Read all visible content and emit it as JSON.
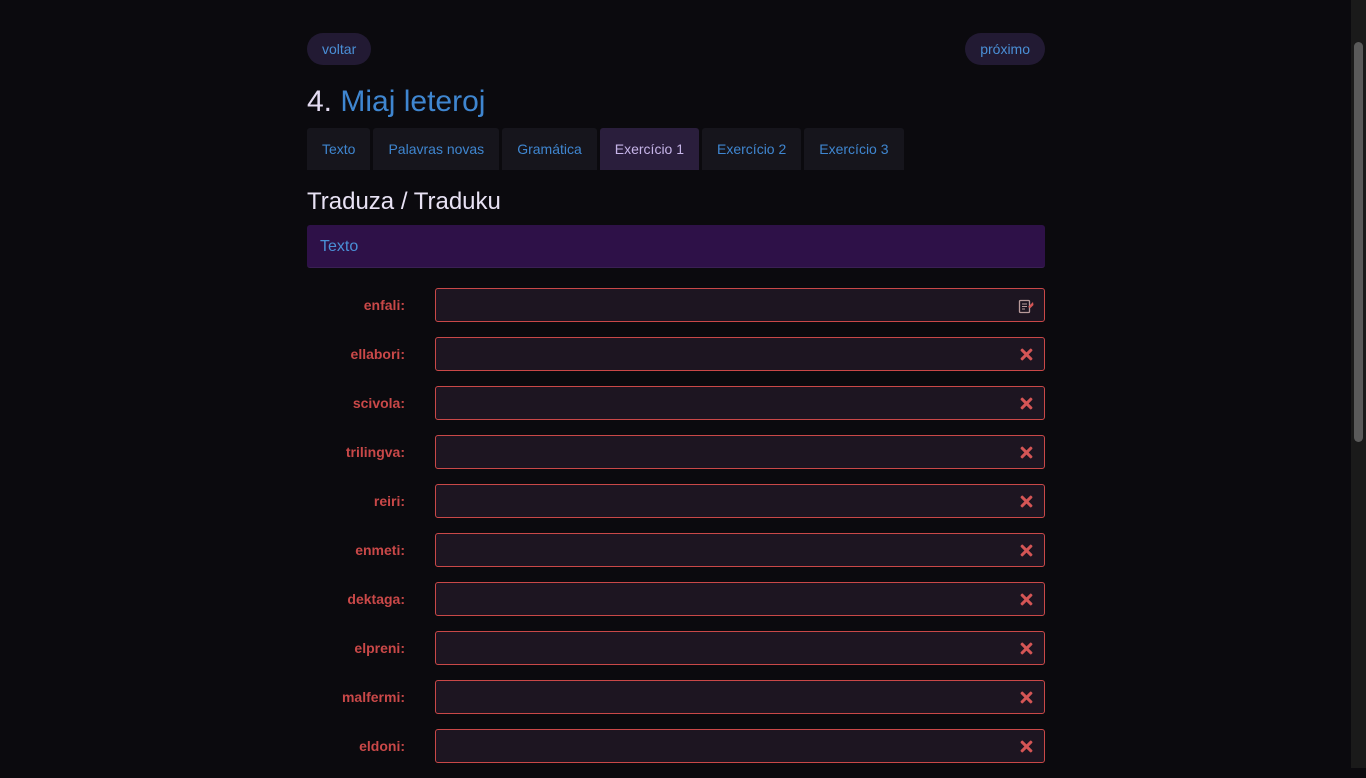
{
  "nav": {
    "prev_label": "voltar",
    "next_label": "próximo"
  },
  "lesson": {
    "number": "4.",
    "title": "Miaj leteroj"
  },
  "tabs": [
    {
      "label": "Texto",
      "active": false
    },
    {
      "label": "Palavras novas",
      "active": false
    },
    {
      "label": "Gramática",
      "active": false
    },
    {
      "label": "Exercício 1",
      "active": true
    },
    {
      "label": "Exercício 2",
      "active": false
    },
    {
      "label": "Exercício 3",
      "active": false
    }
  ],
  "exercise": {
    "heading": "Traduza / Traduku",
    "panel_label": "Texto"
  },
  "rows": [
    {
      "label": "enfali:",
      "value": "",
      "icon": "keyboard-input-icon"
    },
    {
      "label": "ellabori:",
      "value": "",
      "icon": "close-icon"
    },
    {
      "label": "scivola:",
      "value": "",
      "icon": "close-icon"
    },
    {
      "label": "trilingva:",
      "value": "",
      "icon": "close-icon"
    },
    {
      "label": "reiri:",
      "value": "",
      "icon": "close-icon"
    },
    {
      "label": "enmeti:",
      "value": "",
      "icon": "close-icon"
    },
    {
      "label": "dektaga:",
      "value": "",
      "icon": "close-icon"
    },
    {
      "label": "elpreni:",
      "value": "",
      "icon": "close-icon"
    },
    {
      "label": "malfermi:",
      "value": "",
      "icon": "close-icon"
    },
    {
      "label": "eldoni:",
      "value": "",
      "icon": "close-icon"
    }
  ],
  "colors": {
    "background": "#0b0a0e",
    "link": "#3f86d0",
    "error": "#c94848",
    "panel": "#2e1148",
    "active_tab": "#2a1e3c"
  }
}
